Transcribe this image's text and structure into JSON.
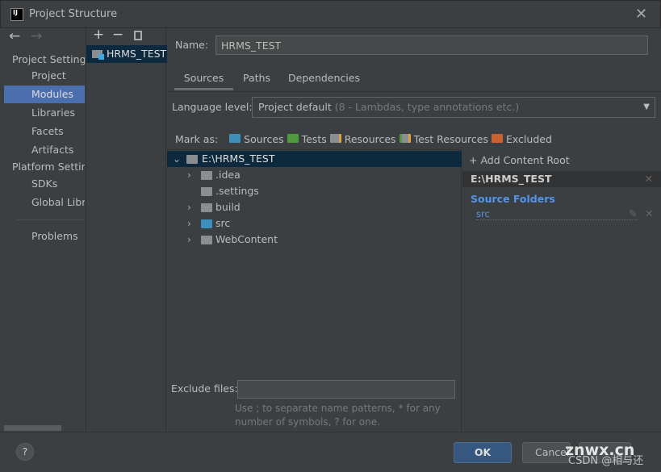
{
  "window": {
    "title": "Project Structure",
    "logo": "IJ"
  },
  "sidebar": {
    "back": "←",
    "forward": "→",
    "items": [
      {
        "label": "Project Settings",
        "type": "header"
      },
      {
        "label": "Project"
      },
      {
        "label": "Modules",
        "selected": true
      },
      {
        "label": "Libraries"
      },
      {
        "label": "Facets"
      },
      {
        "label": "Artifacts"
      },
      {
        "label": "Platform Settings",
        "type": "header"
      },
      {
        "label": "SDKs"
      },
      {
        "label": "Global Libraries"
      },
      {
        "label": "Problems"
      }
    ]
  },
  "modules": {
    "add": "+",
    "remove": "−",
    "items": [
      "HRMS_TEST"
    ]
  },
  "main": {
    "name_label": "Name:",
    "name_value": "HRMS_TEST",
    "tabs": [
      "Sources",
      "Paths",
      "Dependencies"
    ],
    "language_label": "Language level:",
    "language_value": "Project default",
    "language_hint": "(8 - Lambdas, type annotations etc.)",
    "mark_as": "Mark as:",
    "marks": [
      {
        "label": "Sources",
        "color": "#3d8eb9"
      },
      {
        "label": "Tests",
        "color": "#4e9a3d"
      },
      {
        "label": "Resources",
        "color": "#8a8e91"
      },
      {
        "label": "Test Resources",
        "color": "#8a8e91"
      },
      {
        "label": "Excluded",
        "color": "#c9622f"
      }
    ],
    "tree": [
      {
        "label": "E:\\HRMS_TEST",
        "expanded": true
      },
      {
        "label": ".idea"
      },
      {
        "label": ".settings"
      },
      {
        "label": "build"
      },
      {
        "label": "src",
        "color": "#3d8eb9"
      },
      {
        "label": "WebContent"
      }
    ],
    "exclude_label": "Exclude files:",
    "exclude_value": "",
    "exclude_hint": "Use ; to separate name patterns, * for any number of symbols, ? for one."
  },
  "content_root": {
    "add": "Add Content Root",
    "root": "E:\\HRMS_TEST",
    "section": "Source Folders",
    "folders": [
      "src"
    ],
    "accent": "#5394ec"
  },
  "footer": {
    "help": "?",
    "ok": "OK",
    "cancel": "Cancel",
    "apply": ""
  },
  "watermark": {
    "site": "znwx.cn",
    "author": "CSDN @相与还"
  }
}
